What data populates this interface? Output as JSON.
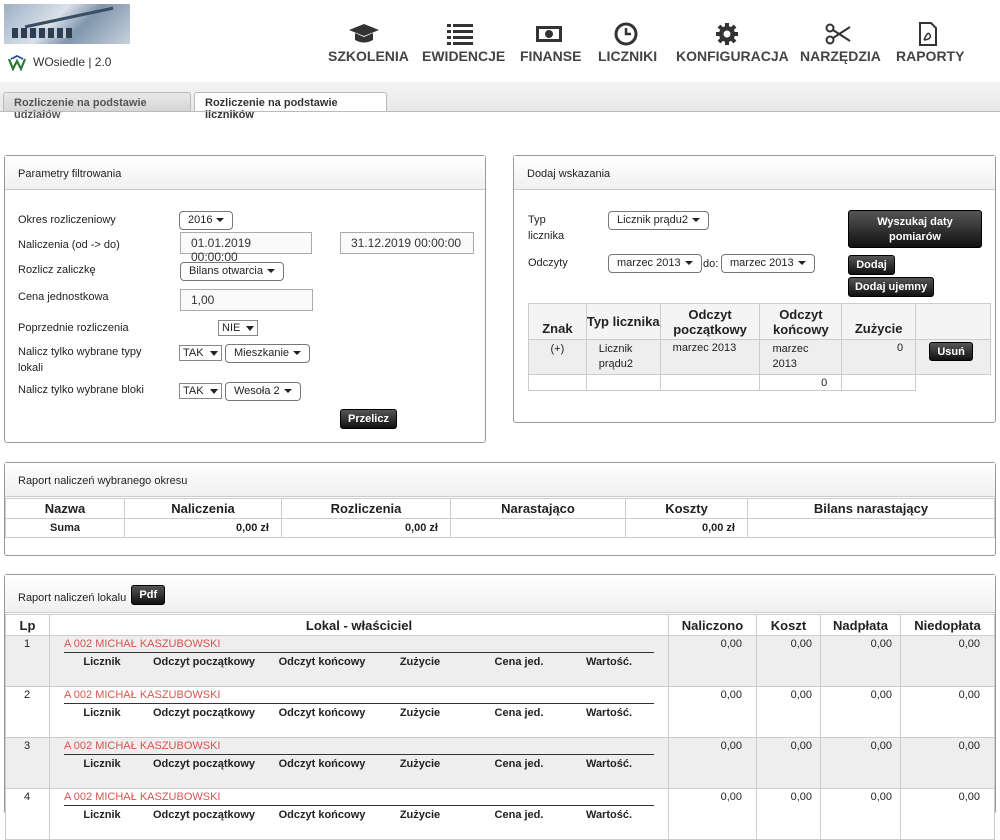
{
  "app": {
    "name": "WOsiedle | 2.0"
  },
  "nav": [
    {
      "label": "SZKOLENIA",
      "icon": "graduation-cap-icon"
    },
    {
      "label": "EWIDENCJE",
      "icon": "list-icon"
    },
    {
      "label": "FINANSE",
      "icon": "money-icon"
    },
    {
      "label": "LICZNIKI",
      "icon": "clock-icon"
    },
    {
      "label": "KONFIGURACJA",
      "icon": "gear-icon"
    },
    {
      "label": "NARZĘDZIA",
      "icon": "scissors-icon"
    },
    {
      "label": "RAPORTY",
      "icon": "pdf-file-icon"
    }
  ],
  "tabs": [
    {
      "label": "Rozliczenie na podstawie udziałów",
      "active": false
    },
    {
      "label": "Rozliczenie na podstawie liczników",
      "active": true
    }
  ],
  "filters": {
    "title": "Parametry filtrowania",
    "period_label": "Okres rozliczeniowy",
    "period_value": "2016",
    "charges_label": "Naliczenia (od -> do)",
    "charges_from": "01.01.2019 00:00:00",
    "charges_to": "31.12.2019 00:00:00",
    "advance_label": "Rozlicz zaliczkę",
    "advance_value": "Bilans otwarcia",
    "unit_price_label": "Cena jednostkowa",
    "unit_price_value": "1,00",
    "previous_label": "Poprzednie rozliczenia",
    "previous_value": "NIE",
    "types_label_1": "Nalicz tylko wybrane typy",
    "types_label_2": "lokali",
    "types_flag": "TAK",
    "types_value": "Mieszkanie",
    "blocks_label": "Nalicz tylko wybrane bloki",
    "blocks_flag": "TAK",
    "blocks_value": "Wesoła 2",
    "recalc_button": "Przelicz"
  },
  "readings": {
    "title": "Dodaj wskazania",
    "type_label_1": "Typ",
    "type_label_2": "licznika",
    "type_value": "Licznik prądu2",
    "search_button_1": "Wyszukaj daty",
    "search_button_2": "pomiarów",
    "reads_label": "Odczyty",
    "from_value": "marzec 2013",
    "to_label": "do:",
    "to_value": "marzec 2013",
    "add_button": "Dodaj",
    "add_negative_button": "Dodaj ujemny",
    "columns": [
      "Znak",
      "Typ licznika",
      "Odczyt początkowy",
      "Odczyt końcowy",
      "Zużycie"
    ],
    "row": {
      "sign": "(+)",
      "type": "Licznik prądu2",
      "start": "marzec 2013",
      "end": "marzec 2013",
      "usage": "0",
      "delete": "Usuń"
    },
    "total": "0"
  },
  "period_report": {
    "title": "Raport naliczeń wybranego okresu",
    "columns": [
      "Nazwa",
      "Naliczenia",
      "Rozliczenia",
      "Narastająco",
      "Koszty",
      "Bilans narastający"
    ],
    "sum_row": {
      "name": "Suma",
      "charges": "0,00 zł",
      "settlements": "0,00 zł",
      "cumulative": "",
      "costs": "0,00 zł",
      "balance": ""
    }
  },
  "unit_report": {
    "title": "Raport naliczeń lokalu",
    "pdf_button": "Pdf",
    "columns": [
      "Lp",
      "Lokal - właściciel",
      "Naliczono",
      "Koszt",
      "Nadpłata",
      "Niedopłata"
    ],
    "sub_columns": [
      "Licznik",
      "Odczyt początkowy",
      "Odczyt końcowy",
      "Zużycie",
      "Cena jed.",
      "Wartość."
    ],
    "rows": [
      {
        "lp": "1",
        "unit": "A 002 MICHAŁ KASZUBOWSKI",
        "charged": "0,00",
        "cost": "0,00",
        "overpay": "0,00",
        "underpay": "0,00"
      },
      {
        "lp": "2",
        "unit": "A 002 MICHAŁ KASZUBOWSKI",
        "charged": "0,00",
        "cost": "0,00",
        "overpay": "0,00",
        "underpay": "0,00"
      },
      {
        "lp": "3",
        "unit": "A 002 MICHAŁ KASZUBOWSKI",
        "charged": "0,00",
        "cost": "0,00",
        "overpay": "0,00",
        "underpay": "0,00"
      },
      {
        "lp": "4",
        "unit": "A 002 MICHAŁ KASZUBOWSKI",
        "charged": "0,00",
        "cost": "0,00",
        "overpay": "0,00",
        "underpay": "0,00"
      }
    ]
  },
  "colors": {
    "accent": "#d9534f",
    "button": "#222222"
  }
}
